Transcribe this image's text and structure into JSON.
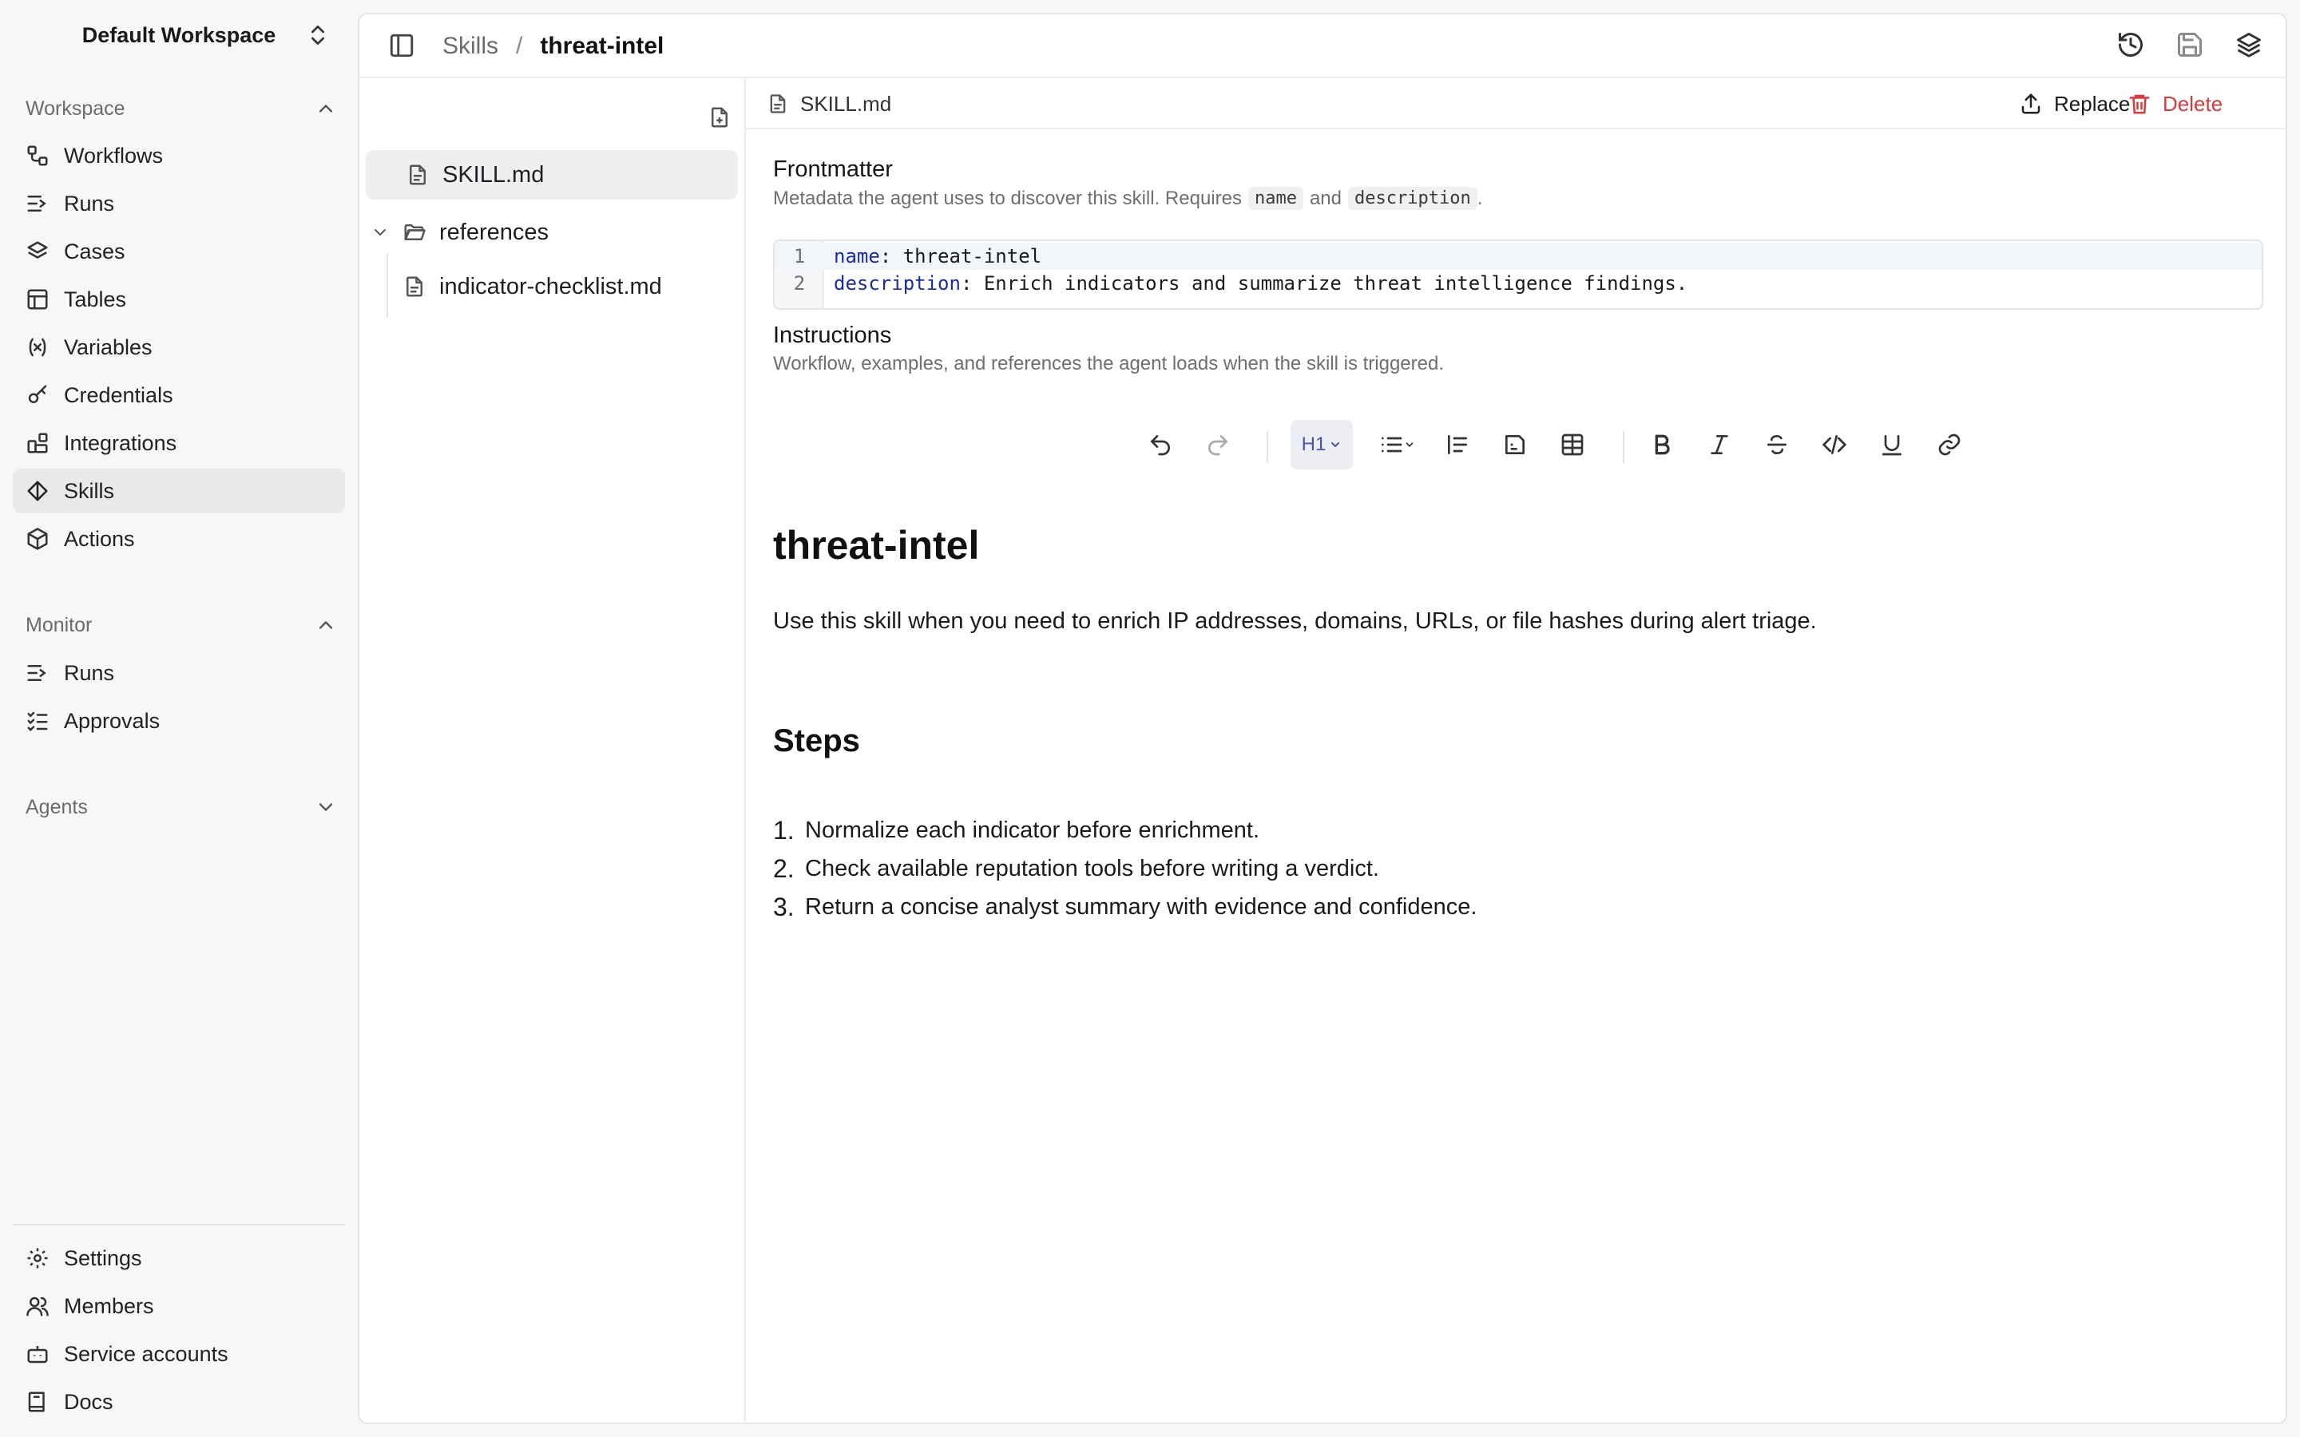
{
  "workspace": {
    "name": "Default Workspace"
  },
  "sidebar": {
    "workspace_group": {
      "title": "Workspace",
      "items": [
        {
          "label": "Workflows",
          "icon": "workflow-icon"
        },
        {
          "label": "Runs",
          "icon": "runs-icon"
        },
        {
          "label": "Cases",
          "icon": "layers-icon"
        },
        {
          "label": "Tables",
          "icon": "table-icon"
        },
        {
          "label": "Variables",
          "icon": "variable-icon"
        },
        {
          "label": "Credentials",
          "icon": "key-icon"
        },
        {
          "label": "Integrations",
          "icon": "integrations-icon"
        },
        {
          "label": "Skills",
          "icon": "skills-icon",
          "active": true
        },
        {
          "label": "Actions",
          "icon": "box-icon"
        }
      ]
    },
    "monitor_group": {
      "title": "Monitor",
      "items": [
        {
          "label": "Runs",
          "icon": "runs-icon"
        },
        {
          "label": "Approvals",
          "icon": "checklist-icon"
        }
      ]
    },
    "agents_group": {
      "title": "Agents"
    },
    "footer_items": [
      {
        "label": "Settings",
        "icon": "gear-icon"
      },
      {
        "label": "Members",
        "icon": "users-icon"
      },
      {
        "label": "Service accounts",
        "icon": "bot-icon"
      },
      {
        "label": "Docs",
        "icon": "book-icon"
      }
    ]
  },
  "breadcrumb": {
    "parent": "Skills",
    "separator": "/",
    "current": "threat-intel"
  },
  "file_tree": {
    "items": [
      {
        "label": "SKILL.md",
        "type": "file",
        "selected": true
      },
      {
        "label": "references",
        "type": "folder",
        "expanded": true
      },
      {
        "label": "indicator-checklist.md",
        "type": "file"
      }
    ]
  },
  "editor": {
    "file_name": "SKILL.md",
    "replace_label": "Replace",
    "delete_label": "Delete",
    "frontmatter": {
      "title": "Frontmatter",
      "subtitle_prefix": "Metadata the agent uses to discover this skill. Requires",
      "code_name": "name",
      "subtitle_and": "and",
      "code_description": "description",
      "subtitle_suffix": ".",
      "lines": [
        {
          "num": "1",
          "key": "name",
          "value": " threat-intel"
        },
        {
          "num": "2",
          "key": "description",
          "value": " Enrich indicators and summarize threat intelligence findings."
        }
      ]
    },
    "instructions": {
      "title": "Instructions",
      "subtitle": "Workflow, examples, and references the agent loads when the skill is triggered."
    },
    "toolbar": {
      "heading_label": "H1"
    },
    "document": {
      "h1": "threat-intel",
      "paragraph": "Use this skill when you need to enrich IP addresses, domains, URLs, or file hashes during alert triage.",
      "h2": "Steps",
      "steps": [
        "Normalize each indicator before enrichment.",
        "Check available reputation tools before writing a verdict.",
        "Return a concise analyst summary with evidence and confidence."
      ],
      "step_numbers": [
        "1.",
        "2.",
        "3."
      ]
    }
  }
}
